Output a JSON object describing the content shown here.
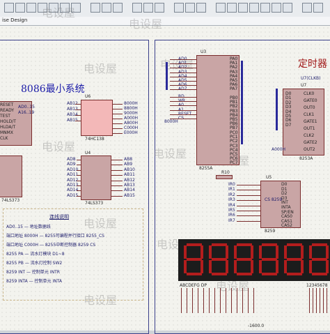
{
  "tab": {
    "label": "ise Design"
  },
  "main_title": "8086最小系统",
  "timer_title": "定时器",
  "watermark": "电设屋",
  "chips": {
    "u6": {
      "ref": "U6",
      "part": "74HC138"
    },
    "u4": {
      "ref": "U4",
      "part": "74LS373"
    },
    "u_left": {
      "part": "74LS373"
    },
    "u3": {
      "ref": "U3",
      "part": "8255A"
    },
    "u7": {
      "ref": "U7",
      "part": "8253A"
    },
    "u5": {
      "ref": "U5",
      "part": "8259"
    },
    "r10": {
      "ref": "R10"
    }
  },
  "cpu_pins": [
    "RESET",
    "READY",
    "TEST",
    "HOLD/T",
    "HLDA/T",
    "MNMX",
    "CLK"
  ],
  "cpu_right": [
    "AD0..15",
    "A16..19"
  ],
  "u6_inputs": [
    "AB12",
    "AB13",
    "AB14",
    "AB15"
  ],
  "u6_outputs": [
    "8000H",
    "8800H",
    "9000H",
    "A000H",
    "A800H",
    "C000H",
    "E000H"
  ],
  "u4_inputs": [
    "AD8",
    "AD9",
    "AD10",
    "AD11",
    "AD12",
    "AD13",
    "AD14",
    "AD15"
  ],
  "u4_outputs": [
    "AB8",
    "AB9",
    "AB10",
    "AB11",
    "AB12",
    "AB13",
    "AB14",
    "AB15"
  ],
  "u3_left": [
    "AD0",
    "AD1",
    "AD2",
    "AD3",
    "AD4",
    "AD5",
    "AD6",
    "AD7"
  ],
  "u3_right": [
    "PA0",
    "PA1",
    "PA2",
    "PA3",
    "PA4",
    "PA5",
    "PA6",
    "PA7"
  ],
  "u3_pb": [
    "PB0",
    "PB1",
    "PB2",
    "PB3",
    "PB4",
    "PB5",
    "PB6",
    "PB7"
  ],
  "u3_pc": [
    "PC0",
    "PC1",
    "PC2",
    "PC3",
    "PC4",
    "PC5",
    "PC6",
    "PC7"
  ],
  "u3_ctrl": [
    "RD",
    "WR",
    "A0",
    "A1",
    "RESET",
    "CS"
  ],
  "u3_net": "8000H",
  "u7_left": [
    "D0",
    "D1",
    "D2",
    "D3",
    "D4",
    "D5",
    "D6",
    "D7"
  ],
  "u7_right": [
    "CLK0",
    "GATE0",
    "OUT0",
    "CLK1",
    "GATE1",
    "OUT1",
    "CLK2",
    "GATE2",
    "OUT2"
  ],
  "u7_net": "A000H",
  "u7_clk": "U7(CLKB)",
  "u5_left": [
    "IR0",
    "IR1",
    "IR2",
    "IR3",
    "IR4",
    "IR5",
    "IR6",
    "IR7"
  ],
  "u5_pins": [
    "D0",
    "D1",
    "D2",
    "D3",
    "INT",
    "INTA",
    "SP/EN",
    "CAS0",
    "CAS1",
    "CAS2"
  ],
  "u5_net": "CS 8259",
  "notes": {
    "heading": "连线说明",
    "lines": [
      "AD0..15 — 地址数据线",
      "端口地址 8000H — 8255可编程并行接口 8255_CS",
      "端口地址 C000H — 8255中断控制器 8259 CS",
      "8255 PA — 流水灯模块 D1~8",
      "8255 PB — 流水灯控制 SW2",
      "8259 INT — 控制单元 INTR",
      "8259 INTA — 控制单元 INTA"
    ]
  },
  "display": {
    "label_left": "ABCDEFG DP",
    "label_right": "12345678"
  },
  "status": {
    "coord": "-1600.0"
  },
  "colors": {
    "canvas": "#f3f3ee",
    "frame": "#3a3f8a",
    "chip": "#c9a5a5",
    "segment": "#b31d1d",
    "wire": "#7a2d2d"
  }
}
